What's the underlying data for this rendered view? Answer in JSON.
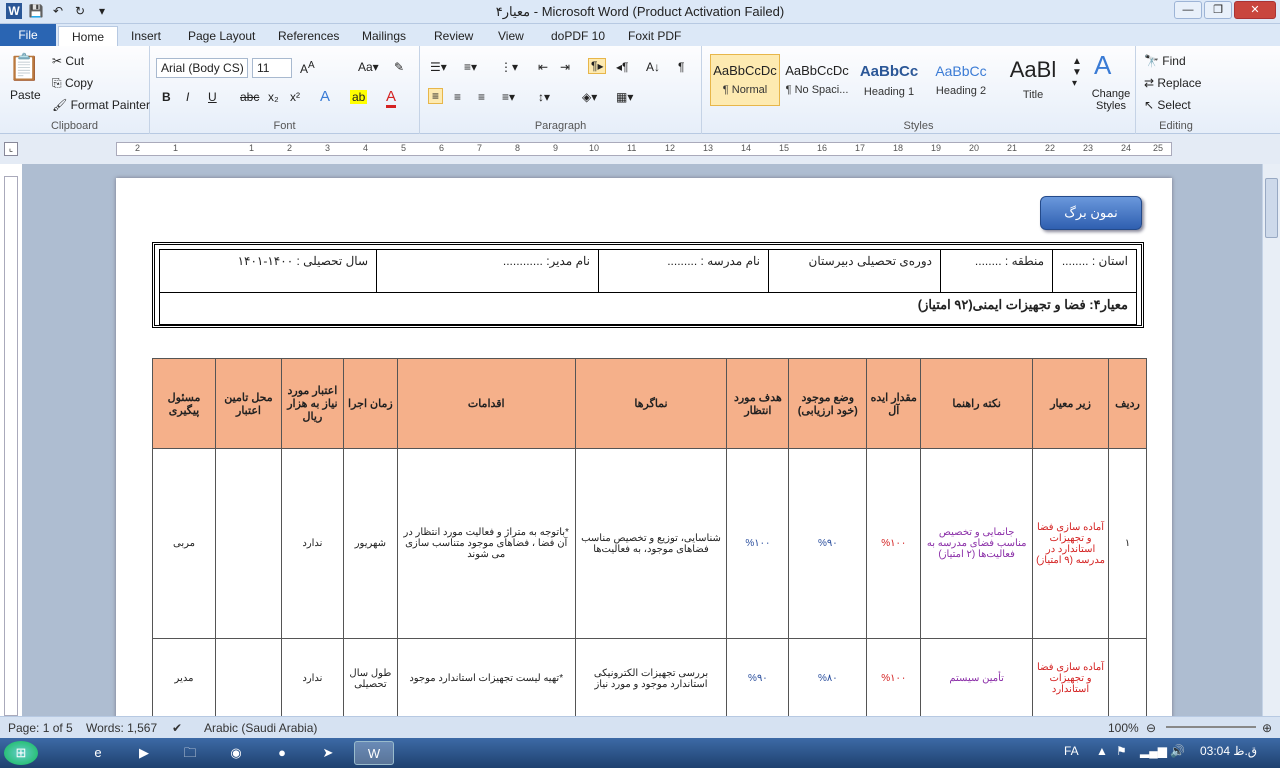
{
  "window": {
    "title": "معیار۴ - Microsoft Word (Product Activation Failed)"
  },
  "tabs": [
    "File",
    "Home",
    "Insert",
    "Page Layout",
    "References",
    "Mailings",
    "Review",
    "View",
    "doPDF 10",
    "Foxit PDF"
  ],
  "clipboard": {
    "paste": "Paste",
    "cut": "Cut",
    "copy": "Copy",
    "format_painter": "Format Painter",
    "label": "Clipboard"
  },
  "font": {
    "name": "Arial (Body CS)",
    "size": "11",
    "label": "Font"
  },
  "paragraph": {
    "label": "Paragraph"
  },
  "styles": {
    "label": "Styles",
    "items": [
      {
        "sample": "AaBbCcDc",
        "name": "¶ Normal"
      },
      {
        "sample": "AaBbCcDc",
        "name": "¶ No Spaci..."
      },
      {
        "sample": "AaBbCc",
        "name": "Heading 1"
      },
      {
        "sample": "AaBbCc",
        "name": "Heading 2"
      },
      {
        "sample": "AaBl",
        "name": "Title"
      }
    ],
    "change": "Change Styles"
  },
  "editing": {
    "find": "Find",
    "replace": "Replace",
    "select": "Select",
    "label": "Editing"
  },
  "document": {
    "badge": "نمون برگ",
    "header_cells": [
      "استان : ........",
      "منطقه : ........",
      "دوره‌ی تحصیلی دبیرستان",
      "نام مدرسه : .........",
      "نام مدیر: ............",
      "سال تحصیلی : ۱۴۰۰-۱۴۰۱"
    ],
    "criterion": "معیار۴:  فضا و تجهیزات ایمنی(۹۲ امتیاز)",
    "columns": [
      "ردیف",
      "زیر معیار",
      "نکته راهنما",
      "مقدار ایده آل",
      "وضع موجود (خود ارزیابی)",
      "هدف مورد انتظار",
      "نماگرها",
      "اقدامات",
      "زمان اجرا",
      "اعتبار مورد نیاز به هزار ریال",
      "محل تامین اعتبار",
      "مسئول پیگیری"
    ],
    "rows": [
      [
        "۱",
        "آماده سازی فضا و تجهیزات استاندارد در مدرسه (۹ امتیاز)",
        "جانمایی و تخصیص مناسب فضای مدرسه به فعالیت‌ها (۲ امتیاز)",
        "%۱۰۰",
        "%۹۰",
        "%۱۰۰",
        "شناسایی، توزیع و تخصیص مناسب فضاهای موجود، به فعالیت‌ها",
        "*باتوجه به متراژ و فعالیت مورد انتظار در آن فضا ، فضاهای موجود متناسب سازی می شوند",
        "شهریور",
        "ندارد",
        "",
        "مربی"
      ],
      [
        "",
        "آماده سازی فضا و تجهیزات استاندارد",
        "تأمین سیستم",
        "%۱۰۰",
        "%۸۰",
        "%۹۰",
        "بررسی تجهیزات الکترونیکی استاندارد موجود و مورد نیاز",
        "*تهیه لیست تجهیزات استاندارد موجود",
        "طول سال تحصیلی",
        "ندارد",
        "",
        "مدیر"
      ]
    ]
  },
  "status": {
    "page": "Page: 1 of 5",
    "words": "Words: 1,567",
    "language": "Arabic (Saudi Arabia)",
    "zoom": "100%"
  },
  "tray": {
    "lang": "FA",
    "time": "03:04 ق.ظ"
  }
}
